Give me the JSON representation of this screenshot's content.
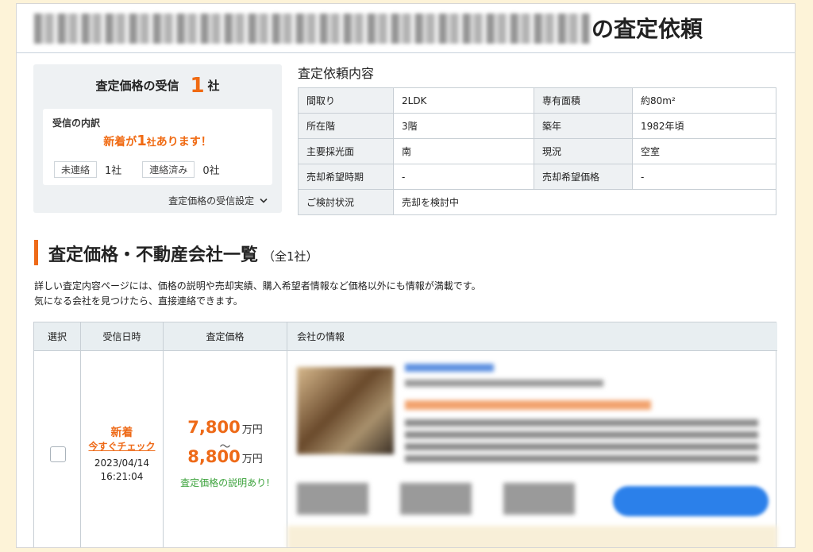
{
  "title": {
    "suffix": "の査定依頼"
  },
  "summary": {
    "heading": "査定価格の受信",
    "count": "1",
    "count_unit": "社",
    "breakdown_title": "受信の内訳",
    "new_notice_pre": "新着が",
    "new_notice_num": "1",
    "new_notice_unit": "社",
    "new_notice_post": "あります！",
    "uncontacted_label": "未連絡",
    "uncontacted_count": "1社",
    "contacted_label": "連絡済み",
    "contacted_count": "0社",
    "settings_link": "査定価格の受信設定"
  },
  "details": {
    "title": "査定依頼内容",
    "rows": [
      [
        "間取り",
        "2LDK",
        "専有面積",
        "約80m²"
      ],
      [
        "所在階",
        "3階",
        "築年",
        "1982年頃"
      ],
      [
        "主要採光面",
        "南",
        "現況",
        "空室"
      ],
      [
        "売却希望時期",
        "-",
        "売却希望価格",
        "-"
      ],
      [
        "ご検討状況",
        "売却を検討中"
      ]
    ]
  },
  "section": {
    "title": "査定価格・不動産会社一覧",
    "total": "（全1社）",
    "desc_line1": "詳しい査定内容ページには、価格の説明や売却実績、購入希望者情報など価格以外にも情報が満載です。",
    "desc_line2": "気になる会社を見つけたら、直接連絡できます。"
  },
  "table": {
    "headers": [
      "選択",
      "受信日時",
      "査定価格",
      "会社の情報"
    ],
    "row": {
      "new_label": "新着",
      "check_link": "今すぐチェック",
      "date": "2023/04/14",
      "time": "16:21:04",
      "price_low": "7,800",
      "price_high": "8,800",
      "price_unit": "万円",
      "tilde": "〜",
      "price_note": "査定価格の説明あり!"
    }
  },
  "colors": {
    "accent": "#ee6a18",
    "note_green": "#3da33d",
    "button_blue": "#2b80ea"
  }
}
